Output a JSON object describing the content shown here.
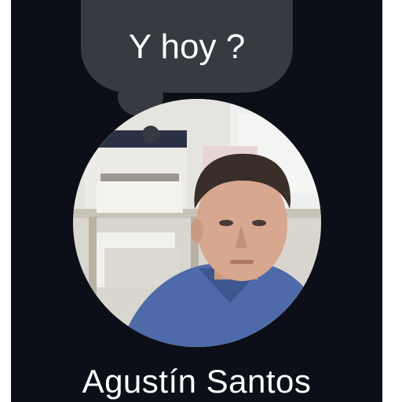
{
  "status_bubble": {
    "text": "Y hoy ?"
  },
  "profile": {
    "name": "Agustín Santos",
    "avatar_icon": "profile-photo"
  },
  "colors": {
    "background": "#0c0f17",
    "bubble": "#373a40",
    "text": "#ffffff"
  }
}
